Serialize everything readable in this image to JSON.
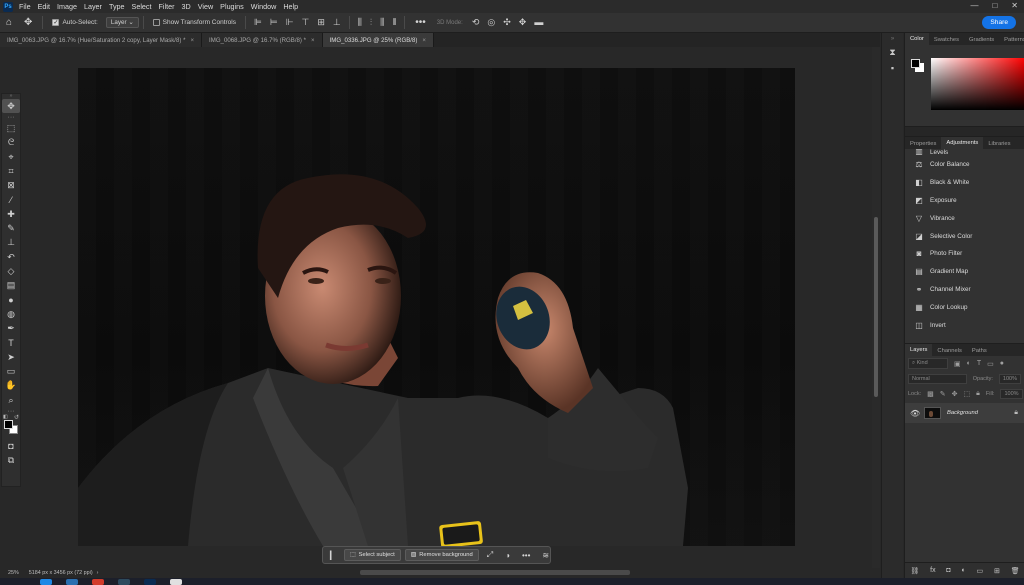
{
  "app": {
    "logo": "Ps",
    "menu": [
      "File",
      "Edit",
      "Image",
      "Layer",
      "Type",
      "Select",
      "Filter",
      "3D",
      "View",
      "Plugins",
      "Window",
      "Help"
    ],
    "window_controls": [
      "—",
      "□",
      "✕"
    ]
  },
  "options_bar": {
    "auto_select_label": "Auto-Select:",
    "auto_select_checked": true,
    "target_value": "Layer",
    "show_transform_label": "Show Transform Controls",
    "mode_3d_label": "3D Mode:",
    "more_label": "•••",
    "share_label": "Share"
  },
  "tabs": [
    {
      "label": "IMG_0063.JPG @ 16.7% (Hue/Saturation 2 copy, Layer Mask/8) *",
      "active": false
    },
    {
      "label": "IMG_0068.JPG @ 16.7% (RGB/8) *",
      "active": false
    },
    {
      "label": "IMG_0336.JPG @ 25% (RGB/8)",
      "active": true
    }
  ],
  "tools": [
    "move",
    "artboard",
    "marquee",
    "lasso",
    "quick-select",
    "crop",
    "frame",
    "eyedropper",
    "healing",
    "brush",
    "clone-stamp",
    "history-brush",
    "eraser",
    "gradient",
    "blur",
    "dodge",
    "pen",
    "type",
    "path-select",
    "rectangle",
    "hand",
    "zoom"
  ],
  "context_bar": {
    "select_subject": "Select subject",
    "remove_background": "Remove background",
    "more": "•••"
  },
  "status": {
    "zoom": "25%",
    "doc_info": "5184 px x 3456 px (72 ppi)"
  },
  "color_panel": {
    "tabs": [
      "Color",
      "Swatches",
      "Gradients",
      "Patterns"
    ],
    "active_tab": "Color",
    "fg_color": "#000000",
    "bg_color": "#ffffff",
    "hue": "#ff0000"
  },
  "adjustments_panel": {
    "tabs": [
      "Properties",
      "Adjustments",
      "Libraries"
    ],
    "active_tab": "Adjustments",
    "items": [
      {
        "label": "Levels",
        "icon": "levels-icon"
      },
      {
        "label": "Color Balance",
        "icon": "color-balance-icon"
      },
      {
        "label": "Black & White",
        "icon": "black-white-icon"
      },
      {
        "label": "Exposure",
        "icon": "exposure-icon"
      },
      {
        "label": "Vibrance",
        "icon": "vibrance-icon"
      },
      {
        "label": "Selective Color",
        "icon": "selective-color-icon"
      },
      {
        "label": "Photo Filter",
        "icon": "photo-filter-icon"
      },
      {
        "label": "Gradient Map",
        "icon": "gradient-map-icon"
      },
      {
        "label": "Channel Mixer",
        "icon": "channel-mixer-icon"
      },
      {
        "label": "Color Lookup",
        "icon": "color-lookup-icon"
      },
      {
        "label": "Invert",
        "icon": "invert-icon"
      }
    ]
  },
  "layers_panel": {
    "tabs": [
      "Layers",
      "Channels",
      "Paths"
    ],
    "active_tab": "Layers",
    "filter_placeholder": "Kind",
    "blend_mode": "Normal",
    "opacity_label": "Opacity:",
    "opacity_value": "100%",
    "lock_label": "Lock:",
    "fill_label": "Fill:",
    "fill_value": "100%",
    "layers": [
      {
        "name": "Background",
        "visible": true
      }
    ]
  }
}
